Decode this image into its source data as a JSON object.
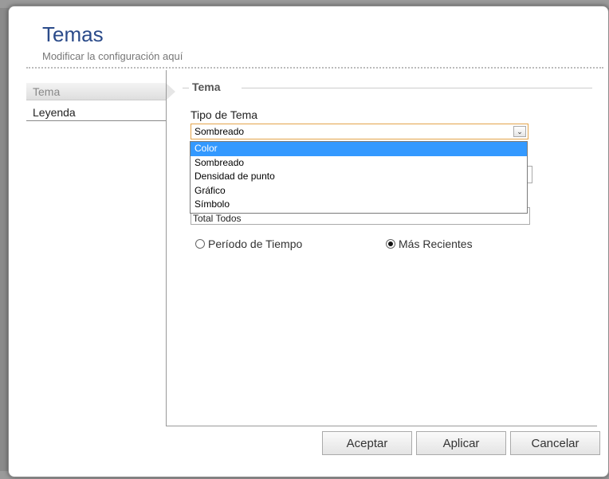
{
  "dialog": {
    "title": "Temas",
    "subtitle": "Modificar la configuración aquí"
  },
  "sidebar": {
    "items": [
      {
        "label": "Tema",
        "active": true
      },
      {
        "label": "Leyenda",
        "active": false
      }
    ]
  },
  "section": {
    "legend": "Tema",
    "tipo_label": "Tipo de Tema",
    "tipo_selected": "Sombreado",
    "tipo_options": [
      "Color",
      "Sombreado",
      "Densidad de punto",
      "Gráfico",
      "Símbolo"
    ],
    "highlighted_option": "Color",
    "total_value": "Total Todos"
  },
  "radios": {
    "periodo_label": "Período de Tiempo",
    "recientes_label": "Más Recientes",
    "selected": "Más Recientes"
  },
  "buttons": {
    "aceptar": "Aceptar",
    "aplicar": "Aplicar",
    "cancelar": "Cancelar"
  },
  "colors": {
    "title": "#2b4b8a",
    "select_border": "#e3a44b",
    "highlight": "#3399ff"
  },
  "icons": {
    "select_arrow": "chevron-down-icon"
  }
}
